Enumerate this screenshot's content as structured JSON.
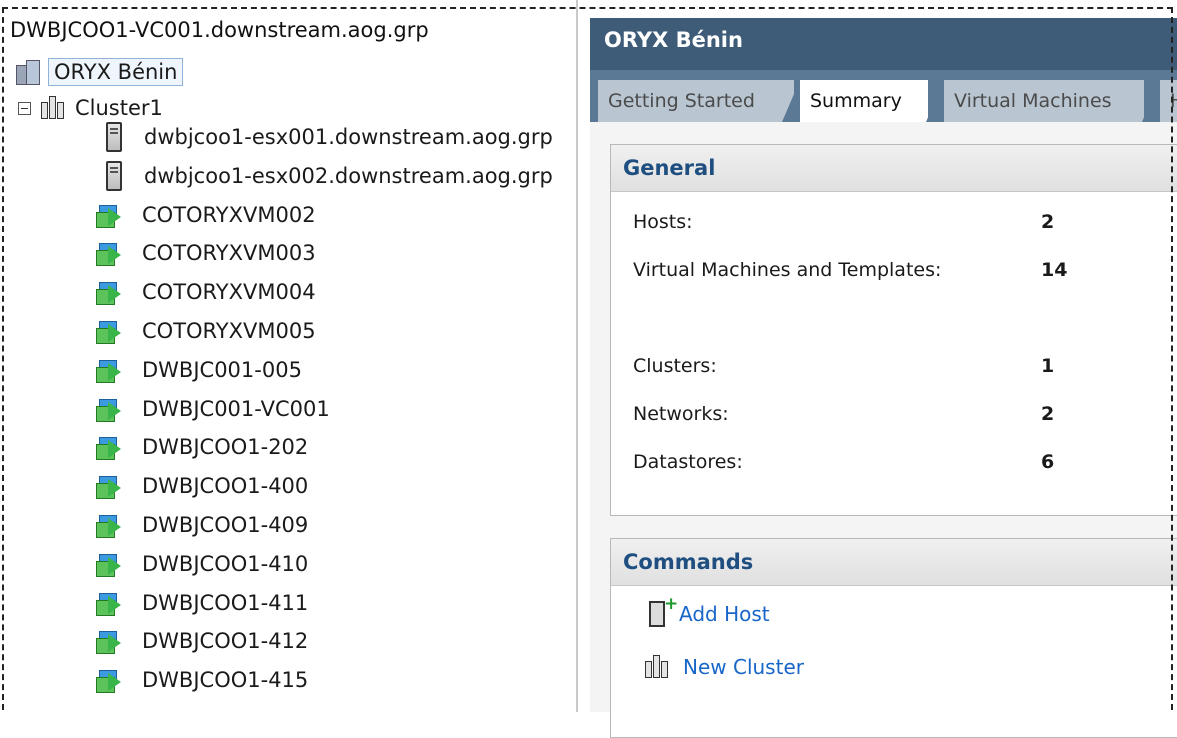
{
  "tree": {
    "root_label": "DWBJCOO1-VC001.downstream.aog.grp",
    "datacenter": {
      "label": "ORYX Bénin",
      "icon": "datacenter-icon"
    },
    "cluster": {
      "label": "Cluster1",
      "icon": "cluster-icon",
      "expanded": true
    },
    "items": [
      {
        "label": "dwbjcoo1-esx001.downstream.aog.grp",
        "type": "host"
      },
      {
        "label": "dwbjcoo1-esx002.downstream.aog.grp",
        "type": "host"
      },
      {
        "label": "COTORYXVM002",
        "type": "vm"
      },
      {
        "label": "COTORYXVM003",
        "type": "vm"
      },
      {
        "label": "COTORYXVM004",
        "type": "vm"
      },
      {
        "label": "COTORYXVM005",
        "type": "vm"
      },
      {
        "label": "DWBJC001-005",
        "type": "vm"
      },
      {
        "label": "DWBJC001-VC001",
        "type": "vm"
      },
      {
        "label": "DWBJCOO1-202",
        "type": "vm"
      },
      {
        "label": "DWBJCOO1-400",
        "type": "vm"
      },
      {
        "label": "DWBJCOO1-409",
        "type": "vm"
      },
      {
        "label": "DWBJCOO1-410",
        "type": "vm"
      },
      {
        "label": "DWBJCOO1-411",
        "type": "vm"
      },
      {
        "label": "DWBJCOO1-412",
        "type": "vm"
      },
      {
        "label": "DWBJCOO1-415",
        "type": "vm"
      }
    ]
  },
  "panel": {
    "title": "ORYX Bénin",
    "tabs": [
      {
        "label": "Getting Started",
        "active": false
      },
      {
        "label": "Summary",
        "active": true
      },
      {
        "label": "Virtual Machines",
        "active": false
      },
      {
        "label": "H",
        "active": false
      }
    ],
    "general": {
      "heading": "General",
      "stats": [
        {
          "label": "Hosts:",
          "value": "2"
        },
        {
          "label": "Virtual Machines and Templates:",
          "value": "14"
        },
        {
          "label": "Clusters:",
          "value": "1"
        },
        {
          "label": "Networks:",
          "value": "2"
        },
        {
          "label": "Datastores:",
          "value": "6"
        }
      ]
    },
    "commands": {
      "heading": "Commands",
      "items": [
        {
          "label": "Add Host",
          "icon": "add-host-icon"
        },
        {
          "label": "New Cluster",
          "icon": "cluster-icon"
        }
      ]
    }
  },
  "colors": {
    "header_bg": "#3e5b78",
    "tabs_bg": "#5b7895",
    "section_heading": "#1f4f80",
    "link": "#1866c8"
  }
}
